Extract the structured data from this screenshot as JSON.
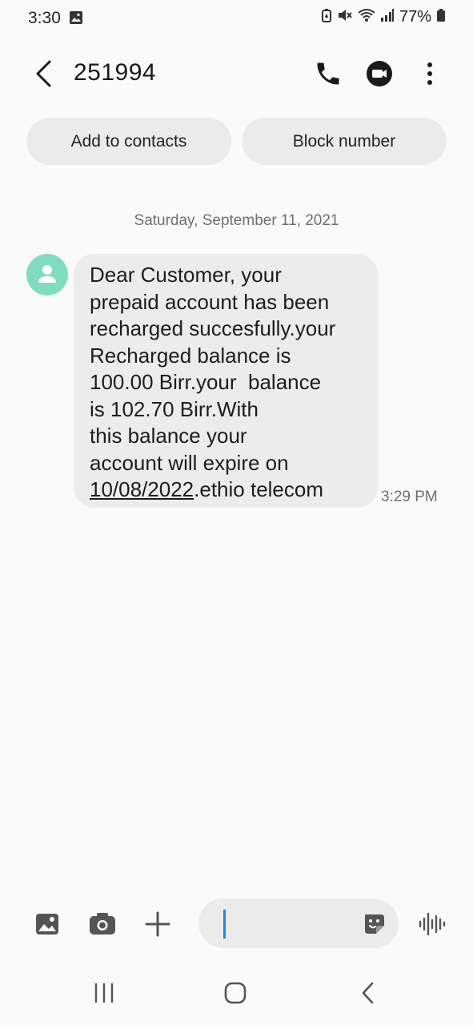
{
  "status_bar": {
    "time": "3:30",
    "battery_percent": "77%"
  },
  "header": {
    "contact": "251994"
  },
  "actions": {
    "add_to_contacts": "Add to contacts",
    "block_number": "Block number"
  },
  "conversation": {
    "date": "Saturday, September 11, 2021",
    "message": {
      "lines": [
        "Dear Customer, your",
        "prepaid account has been",
        "recharged succesfully.your",
        "Recharged balance is",
        "100.00 Birr.your  balance",
        "is 102.70 Birr.With",
        "this balance your",
        "account will expire on"
      ],
      "last_line_link": "10/08/2022",
      "last_line_rest": ".ethio telecom",
      "time": "3:29 PM"
    }
  },
  "composer": {
    "placeholder": ""
  },
  "icons": {
    "gallery": "gallery-icon",
    "camera": "camera-icon",
    "plus": "plus-icon",
    "sticker": "sticker-icon",
    "voice": "voice-wave-icon",
    "call": "phone-icon",
    "video": "video-call-icon",
    "more": "more-vertical-icon",
    "back": "back-arrow-icon"
  },
  "colors": {
    "avatar": "#7fdcbf",
    "bubble": "#ececec",
    "chip": "#ebebeb",
    "cursor": "#1d8be0",
    "background": "#fafafa"
  }
}
